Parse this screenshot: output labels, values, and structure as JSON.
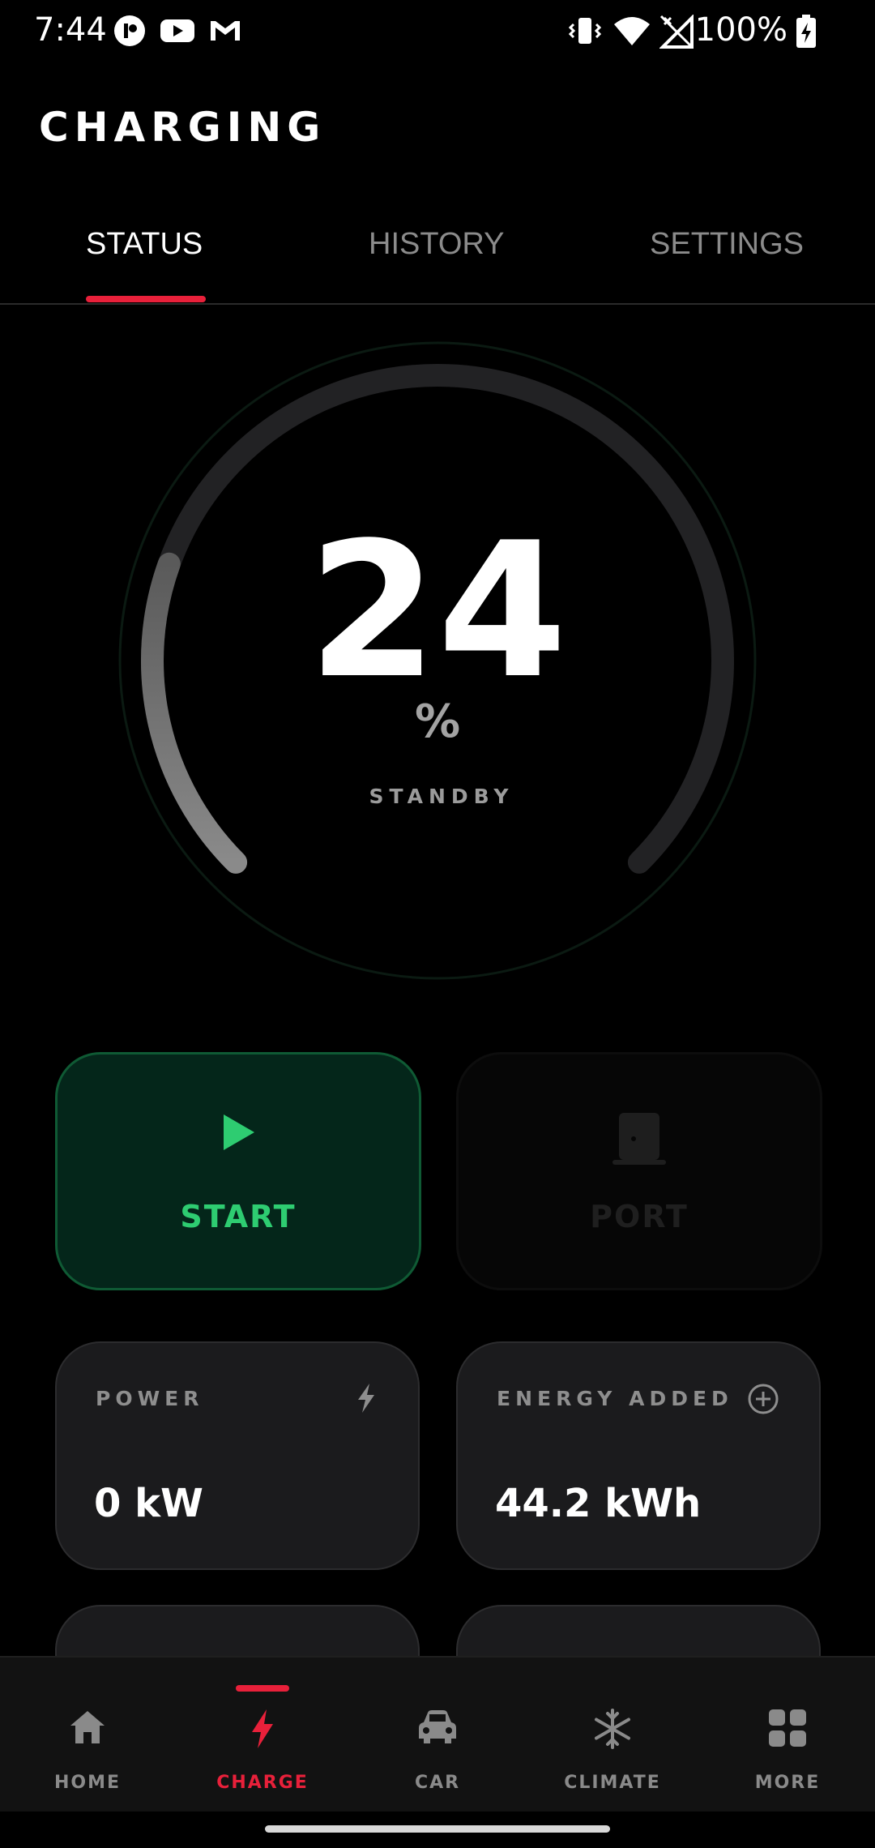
{
  "status_bar": {
    "time": "7:44",
    "battery": "100%",
    "icons": [
      "app-icon",
      "youtube-icon",
      "gmail-icon",
      "vibrate-icon",
      "wifi-icon",
      "signal-icon",
      "battery-charging-icon"
    ]
  },
  "header": {
    "title": "CHARGING"
  },
  "tabs": [
    {
      "label": "STATUS",
      "active": true
    },
    {
      "label": "HISTORY",
      "active": false
    },
    {
      "label": "SETTINGS",
      "active": false
    }
  ],
  "gauge": {
    "value": "24",
    "unit": "%",
    "status": "STANDBY",
    "level_fraction": 0.24
  },
  "actions": {
    "start_label": "START",
    "port_label": "PORT"
  },
  "cards": {
    "power": {
      "label": "POWER",
      "value": "0 kW"
    },
    "energy": {
      "label": "ENERGY ADDED",
      "value": "44.2 kWh"
    }
  },
  "nav": [
    {
      "label": "HOME",
      "active": false
    },
    {
      "label": "CHARGE",
      "active": true
    },
    {
      "label": "CAR",
      "active": false
    },
    {
      "label": "CLIMATE",
      "active": false
    },
    {
      "label": "MORE",
      "active": false
    }
  ],
  "colors": {
    "accent": "#e8203a",
    "start_green": "#2ecc71",
    "card_bg": "#1b1b1d"
  }
}
